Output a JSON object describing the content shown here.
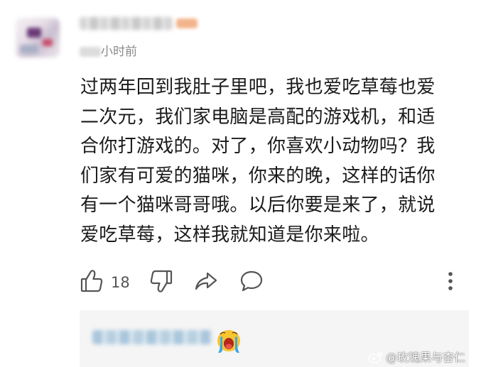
{
  "comment": {
    "time_text": "小时前",
    "lines": [
      "过两年回到我肚子里吧，我也爱吃草莓也爱",
      "二次元，我们家电脑是高配的游戏机，和适",
      "合你打游戏的。对了，你喜欢小动物吗？我",
      "们家有可爱的猫咪，你来的晚，这样的话你",
      "有一个猫咪哥哥哦。以后你要是来了，就说",
      "爱吃草莓，这样我就知道是你来啦。"
    ]
  },
  "actions": {
    "like_count": "18",
    "icons": [
      "thumbs-up-icon",
      "thumbs-down-icon",
      "share-icon",
      "comment-icon",
      "more-vertical-icon"
    ]
  },
  "reply": {
    "emoji": "crying-face-emoji"
  },
  "watermark": {
    "text": "@玫瑰果与杏仁"
  },
  "colors": {
    "text": "#1b1b1b",
    "muted": "#8a8a8a",
    "reply_bg": "#f5f5f5",
    "blur_name": "#a9c6dc"
  }
}
